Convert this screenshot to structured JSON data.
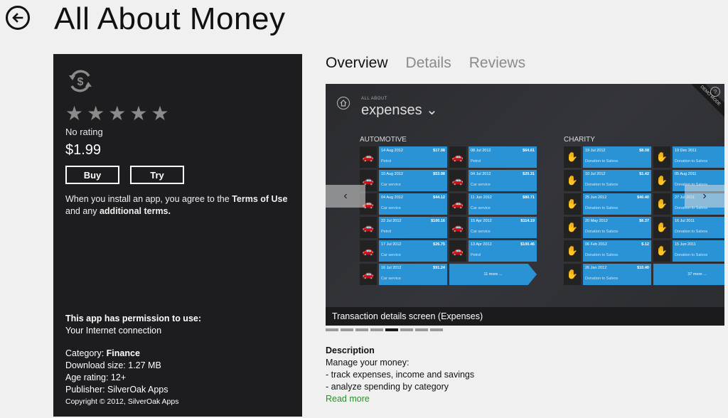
{
  "header": {
    "title": "All About Money"
  },
  "info": {
    "rating_text": "No rating",
    "stars_filled": 0,
    "stars_total": 5,
    "price": "$1.99",
    "buy_label": "Buy",
    "try_label": "Try",
    "terms_prefix": "When you install an app, you agree to the ",
    "terms_link": "Terms of Use",
    "terms_mid": " and any ",
    "terms_link2": "additional terms.",
    "permission_heading": "This app has permission to use:",
    "permission_item": "Your Internet connection",
    "category_label": "Category: ",
    "category_value": "Finance",
    "download_size": "Download size: 1.27 MB",
    "age_rating": "Age rating: 12+",
    "publisher": "Publisher: SilverOak Apps",
    "copyright": "Copyright © 2012, SilverOak Apps"
  },
  "tabs": [
    {
      "label": "Overview",
      "active": true
    },
    {
      "label": "Details",
      "active": false
    },
    {
      "label": "Reviews",
      "active": false
    }
  ],
  "screenshot": {
    "all_about": "ALL ABOUT",
    "heading": "expenses ⌄",
    "demo_mode": "DEMO MODE",
    "help": "?",
    "caption": "Transaction details screen (Expenses)",
    "automotive_label": "AUTOMOTIVE",
    "charity_label": "CHARITY",
    "automotive": [
      [
        {
          "d": "14 Aug 2012",
          "a": "$17.98",
          "n": "Petrol"
        },
        {
          "d": "08 Jul 2012",
          "a": "$64.61",
          "n": "Petrol"
        }
      ],
      [
        {
          "d": "10 Aug 2012",
          "a": "$53.98",
          "n": "Car service"
        },
        {
          "d": "04 Jul 2012",
          "a": "$20.31",
          "n": "Car service"
        }
      ],
      [
        {
          "d": "04 Aug 2012",
          "a": "$44.12",
          "n": "Car service"
        },
        {
          "d": "11 Jun 2012",
          "a": "$80.71",
          "n": "Car service"
        }
      ],
      [
        {
          "d": "22 Jul 2012",
          "a": "$100.16",
          "n": "Petrol"
        },
        {
          "d": "15 Apr 2012",
          "a": "$114.19",
          "n": "Car service"
        }
      ],
      [
        {
          "d": "17 Jul 2012",
          "a": "$26.75",
          "n": "Car service"
        },
        {
          "d": "13 Apr 2012",
          "a": "$100.46",
          "n": "Petrol"
        }
      ],
      [
        {
          "d": "16 Jul 2012",
          "a": "$91.24",
          "n": "Car service"
        }
      ]
    ],
    "automotive_more": "11 more ...",
    "charity": [
      [
        {
          "d": "19 Jul 2012",
          "a": "$8.08",
          "n": "Donation to Salvos"
        },
        {
          "d": "19 Dec 2011",
          "a": "",
          "n": "Donation to Salvos"
        }
      ],
      [
        {
          "d": "10 Jul 2012",
          "a": "$1.42",
          "n": "Donation to Salvos"
        },
        {
          "d": "05 Aug 2011",
          "a": "",
          "n": "Donation to Salvos"
        }
      ],
      [
        {
          "d": "25 Jun 2012",
          "a": "$40.40",
          "n": "Donation to Salvos"
        },
        {
          "d": "27 Jul 2011",
          "a": "",
          "n": "Donation to Salvos"
        }
      ],
      [
        {
          "d": "20 May 2012",
          "a": "$6.37",
          "n": "Donation to Salvos"
        },
        {
          "d": "16 Jul 2011",
          "a": "",
          "n": "Donation to Salvos"
        }
      ],
      [
        {
          "d": "06 Feb 2012",
          "a": "$.12",
          "n": "Donation to Salvos"
        },
        {
          "d": "15 Jun 2011",
          "a": "",
          "n": "Donation to Salvos"
        }
      ],
      [
        {
          "d": "26 Jan 2012",
          "a": "$10.40",
          "n": "Donation to Salvos"
        }
      ]
    ],
    "charity_more": "37 more ...",
    "prev_arrow": "‹",
    "next_arrow": "›"
  },
  "carousel": {
    "count": 8,
    "active_index": 4
  },
  "description": {
    "heading": "Description",
    "line1": "Manage your money:",
    "line2": "- track expenses, income and savings",
    "line3": "- analyze spending by category",
    "read_more": "Read more"
  },
  "icons": {
    "back": "back-arrow-icon",
    "app": "dollar-cycle-icon",
    "star": "star-icon"
  }
}
